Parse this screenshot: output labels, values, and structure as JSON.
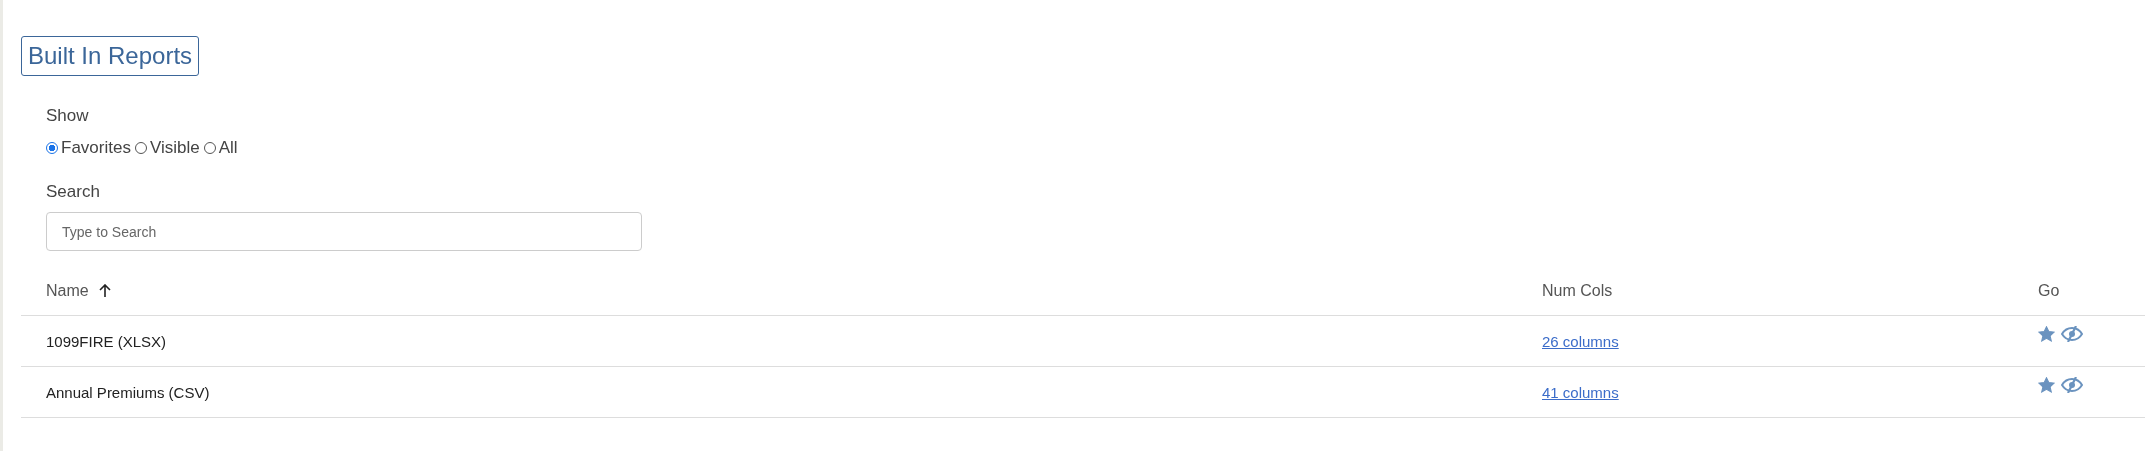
{
  "title": "Built In Reports",
  "show": {
    "label": "Show",
    "options": [
      {
        "label": "Favorites",
        "selected": true
      },
      {
        "label": "Visible",
        "selected": false
      },
      {
        "label": "All",
        "selected": false
      }
    ]
  },
  "search": {
    "label": "Search",
    "placeholder": "Type to Search"
  },
  "table": {
    "columns": [
      {
        "label": "Name",
        "sorted_ascending": true
      },
      {
        "label": "Num Cols"
      },
      {
        "label": "Go"
      }
    ],
    "rows": [
      {
        "name": "1099FIRE (XLSX)",
        "num_cols": "26 columns",
        "favorite": true,
        "visible": false
      },
      {
        "name": "Annual Premiums (CSV)",
        "num_cols": "41 columns",
        "favorite": true,
        "visible": false
      }
    ]
  }
}
